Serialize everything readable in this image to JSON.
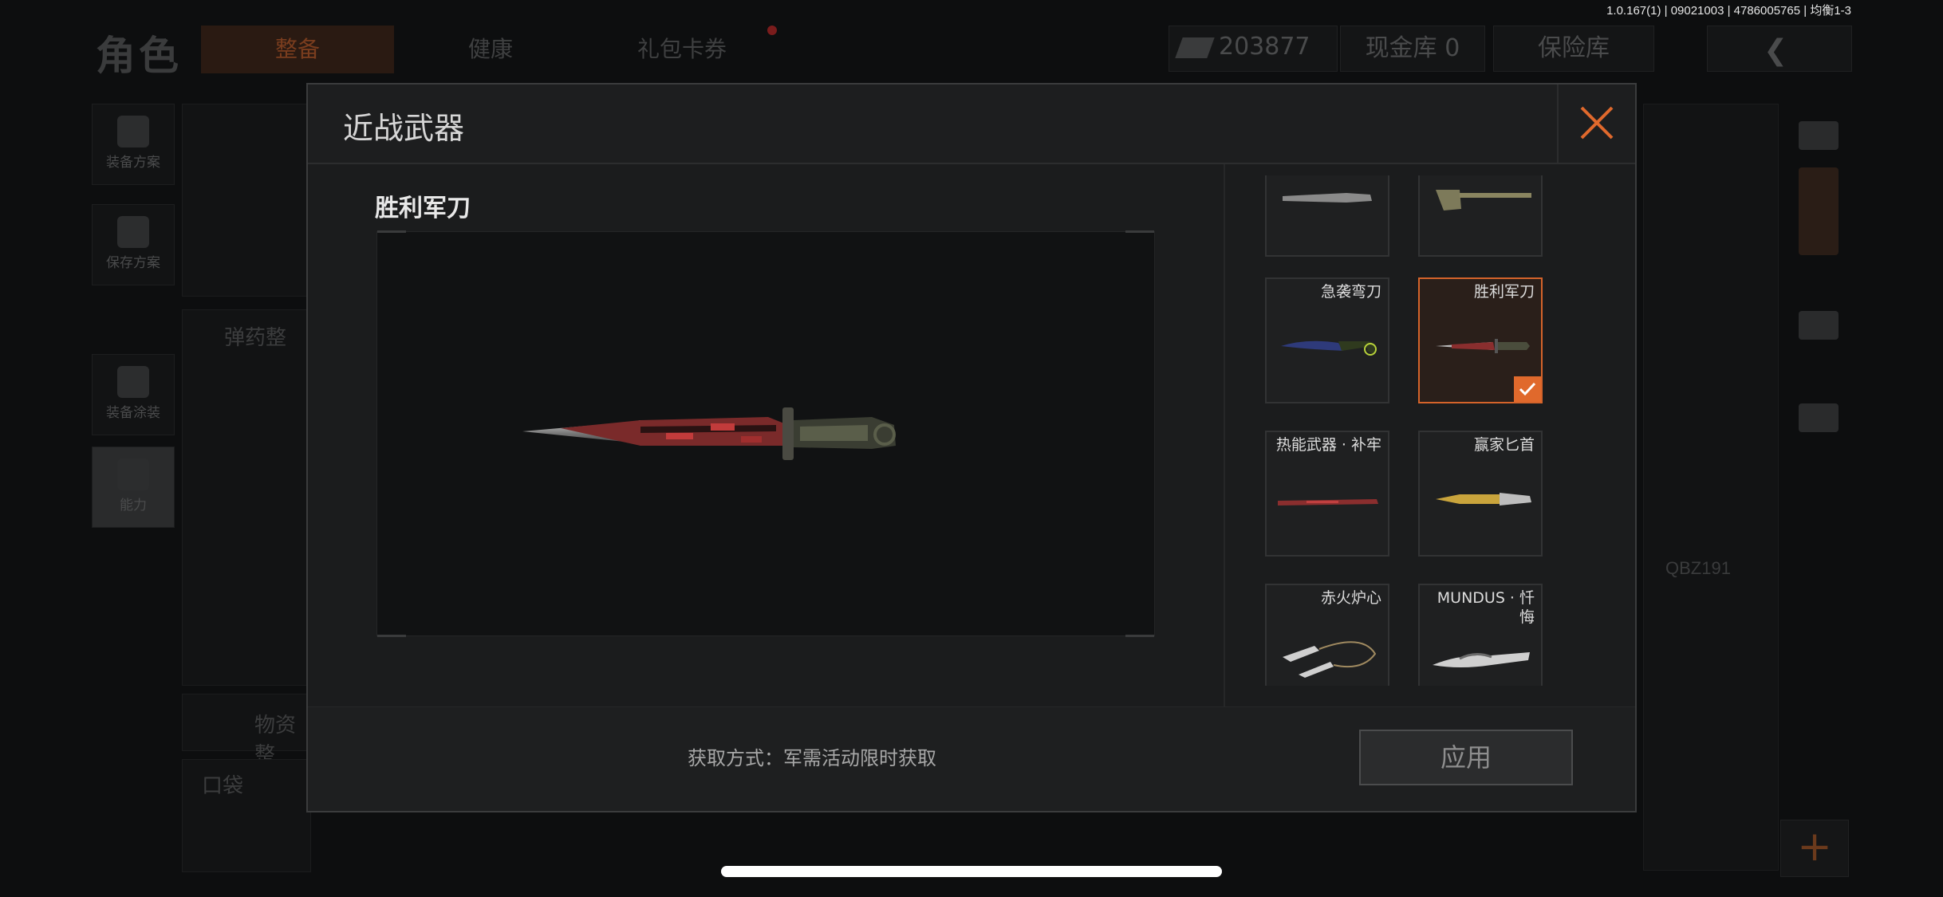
{
  "status": {
    "version": "1.0.167(1) | 09021003 | 4786005765 | 均衡1-3"
  },
  "background": {
    "page_title": "角色",
    "tabs": [
      {
        "label": "整备"
      },
      {
        "label": "健康"
      },
      {
        "label": "礼包卡券"
      }
    ],
    "money": "203877",
    "cash_vault": "现金库 0",
    "insurance": "保险库",
    "side_buttons": [
      {
        "label": "装备方案"
      },
      {
        "label": "保存方案"
      },
      {
        "label": "装备涂装"
      },
      {
        "label": "能力"
      }
    ],
    "panel_labels": [
      "弹药整",
      "物资整",
      "口袋"
    ],
    "weapon_tag": "QBZ191",
    "add_button": "+"
  },
  "dialog": {
    "title": "近战武器",
    "selected_name": "胜利军刀",
    "items": [
      {
        "name": "",
        "icon": "knife-icon"
      },
      {
        "name": "",
        "icon": "cleaver-icon"
      },
      {
        "name": "急袭弯刀",
        "icon": "karambit-icon"
      },
      {
        "name": "胜利军刀",
        "icon": "combat-knife-icon",
        "selected": true
      },
      {
        "name": "热能武器 · 补牢",
        "icon": "blade-icon"
      },
      {
        "name": "赢家匕首",
        "icon": "dagger-icon"
      },
      {
        "name": "赤火炉心",
        "icon": "dual-blade-icon"
      },
      {
        "name": "MUNDUS · 忏悔",
        "icon": "ornate-knife-icon"
      }
    ],
    "acquire_text": "获取方式：军需活动限时获取",
    "apply_label": "应用"
  },
  "colors": {
    "accent": "#e0692c",
    "panel": "#1b1c1d",
    "background": "#0d0e0f"
  }
}
